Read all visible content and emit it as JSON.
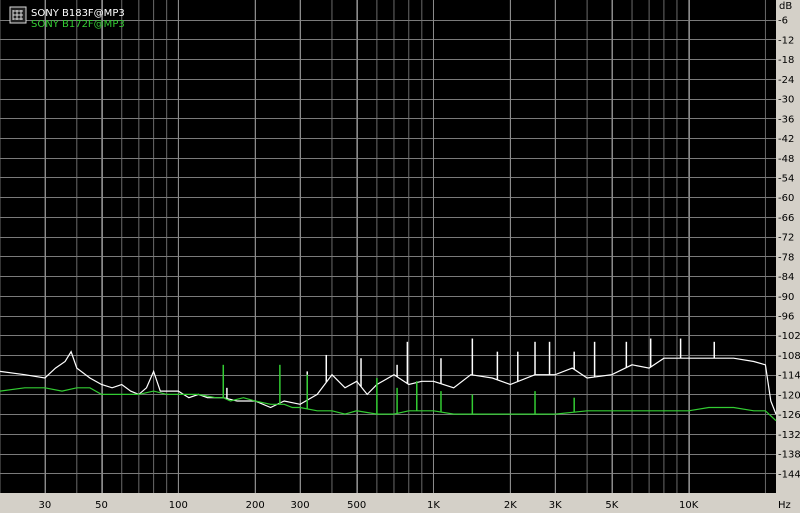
{
  "chart_data": {
    "type": "line",
    "xscale": "log",
    "xlim": [
      20,
      22000
    ],
    "ylim": [
      -150,
      0
    ],
    "grid": true,
    "legend": "top-left",
    "ylabel": "dB",
    "xlabel": "Hz",
    "yticks": [
      -6,
      -12,
      -18,
      -24,
      -30,
      -36,
      -42,
      -48,
      -54,
      -60,
      -66,
      -72,
      -78,
      -84,
      -90,
      -96,
      -102,
      -108,
      -114,
      -120,
      -126,
      -132,
      -138,
      -144
    ],
    "xticks": [
      {
        "v": 30,
        "label": "30"
      },
      {
        "v": 50,
        "label": "50"
      },
      {
        "v": 100,
        "label": "100"
      },
      {
        "v": 200,
        "label": "200"
      },
      {
        "v": 300,
        "label": "300"
      },
      {
        "v": 500,
        "label": "500"
      },
      {
        "v": 1000,
        "label": "1K"
      },
      {
        "v": 2000,
        "label": "2K"
      },
      {
        "v": 3000,
        "label": "3K"
      },
      {
        "v": 5000,
        "label": "5K"
      },
      {
        "v": 10000,
        "label": "10K"
      }
    ],
    "series": [
      {
        "name": "SONY B183F@MP3",
        "color": "#ffffff",
        "x": [
          20,
          25,
          30,
          33,
          36,
          38,
          40,
          45,
          50,
          55,
          60,
          65,
          70,
          75,
          80,
          85,
          90,
          100,
          110,
          120,
          130,
          150,
          170,
          200,
          230,
          260,
          300,
          350,
          400,
          450,
          500,
          550,
          600,
          700,
          800,
          900,
          1000,
          1200,
          1400,
          1700,
          2000,
          2500,
          3000,
          3500,
          4000,
          5000,
          6000,
          7000,
          8000,
          10000,
          12000,
          15000,
          18000,
          20000,
          21000,
          22000
        ],
        "y": [
          -113,
          -114,
          -115,
          -112,
          -110,
          -107,
          -112,
          -115,
          -117,
          -118,
          -117,
          -119,
          -120,
          -118,
          -113,
          -119,
          -119,
          -119,
          -121,
          -120,
          -121,
          -121,
          -122,
          -122,
          -124,
          -122,
          -123,
          -120,
          -114,
          -118,
          -116,
          -120,
          -117,
          -114,
          -117,
          -116,
          -116,
          -118,
          -114,
          -115,
          -117,
          -114,
          -114,
          -112,
          -115,
          -114,
          -111,
          -112,
          -109,
          -109,
          -109,
          -109,
          -110,
          -111,
          -122,
          -126
        ]
      },
      {
        "name": "SONY B172F@MP3",
        "color": "#33cc33",
        "x": [
          20,
          25,
          30,
          35,
          40,
          45,
          50,
          60,
          70,
          80,
          90,
          100,
          120,
          140,
          150,
          160,
          180,
          200,
          230,
          260,
          280,
          300,
          350,
          400,
          450,
          500,
          600,
          700,
          800,
          1000,
          1200,
          1500,
          2000,
          2500,
          3000,
          4000,
          5000,
          6000,
          8000,
          10000,
          12000,
          15000,
          18000,
          20000,
          22000
        ],
        "y": [
          -119,
          -118,
          -118,
          -119,
          -118,
          -118,
          -120,
          -120,
          -120,
          -119,
          -120,
          -120,
          -120,
          -121,
          -121,
          -122,
          -121,
          -122,
          -123,
          -123,
          -124,
          -124,
          -125,
          -125,
          -126,
          -125,
          -126,
          -126,
          -125,
          -125,
          -126,
          -126,
          -126,
          -126,
          -126,
          -125,
          -125,
          -125,
          -125,
          -125,
          -124,
          -124,
          -125,
          -125,
          -128
        ]
      }
    ],
    "spikes": [
      {
        "series": 0,
        "x": 155,
        "y": -118
      },
      {
        "series": 0,
        "x": 320,
        "y": -113
      },
      {
        "series": 0,
        "x": 380,
        "y": -108
      },
      {
        "series": 0,
        "x": 520,
        "y": -109
      },
      {
        "series": 0,
        "x": 720,
        "y": -111
      },
      {
        "series": 0,
        "x": 790,
        "y": -104
      },
      {
        "series": 0,
        "x": 1070,
        "y": -109
      },
      {
        "series": 0,
        "x": 1420,
        "y": -103
      },
      {
        "series": 0,
        "x": 1780,
        "y": -107
      },
      {
        "series": 0,
        "x": 2140,
        "y": -107
      },
      {
        "series": 0,
        "x": 2500,
        "y": -104
      },
      {
        "series": 0,
        "x": 2850,
        "y": -104
      },
      {
        "series": 0,
        "x": 3560,
        "y": -107
      },
      {
        "series": 0,
        "x": 4280,
        "y": -104
      },
      {
        "series": 0,
        "x": 5700,
        "y": -104
      },
      {
        "series": 0,
        "x": 7100,
        "y": -103
      },
      {
        "series": 0,
        "x": 9300,
        "y": -103
      },
      {
        "series": 0,
        "x": 12600,
        "y": -104
      },
      {
        "series": 1,
        "x": 150,
        "y": -111
      },
      {
        "series": 1,
        "x": 250,
        "y": -111
      },
      {
        "series": 1,
        "x": 320,
        "y": -114
      },
      {
        "series": 1,
        "x": 600,
        "y": -115
      },
      {
        "series": 1,
        "x": 720,
        "y": -118
      },
      {
        "series": 1,
        "x": 860,
        "y": -116
      },
      {
        "series": 1,
        "x": 1070,
        "y": -119
      },
      {
        "series": 1,
        "x": 1420,
        "y": -120
      },
      {
        "series": 1,
        "x": 2500,
        "y": -119
      },
      {
        "series": 1,
        "x": 3560,
        "y": -121
      }
    ]
  }
}
